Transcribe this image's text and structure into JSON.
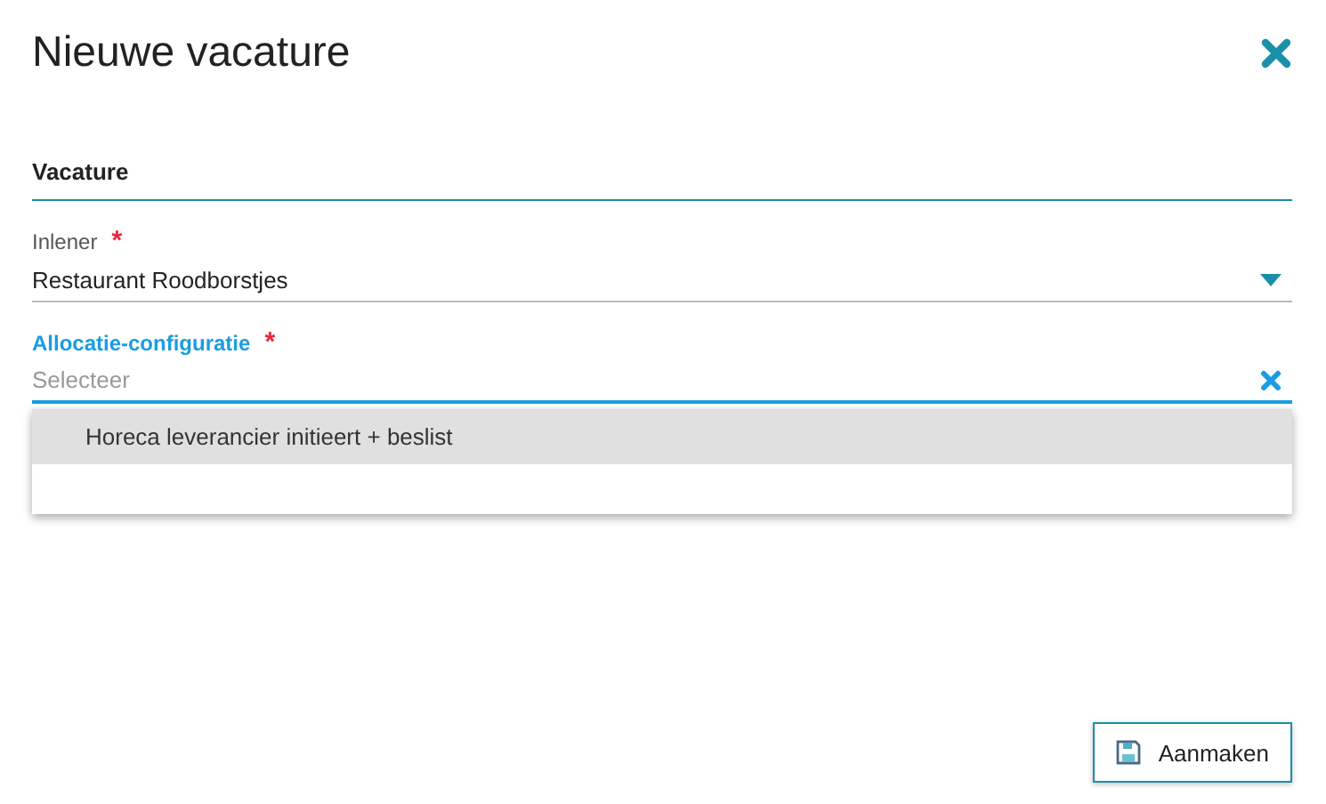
{
  "dialog": {
    "title": "Nieuwe vacature"
  },
  "section": {
    "title": "Vacature"
  },
  "fields": [
    {
      "kind": "select",
      "label": "Inlener",
      "required_mark": "*",
      "value": "Restaurant Roodborstjes",
      "focused": false
    },
    {
      "kind": "search",
      "label": "Allocatie-configuratie",
      "required_mark": "*",
      "placeholder": "Selecteer",
      "focused": true,
      "options": [
        {
          "label": "Horeca leverancier initieert + beslist",
          "selected": true
        }
      ]
    }
  ],
  "buttons": [
    {
      "label": "Aanmaken"
    }
  ]
}
